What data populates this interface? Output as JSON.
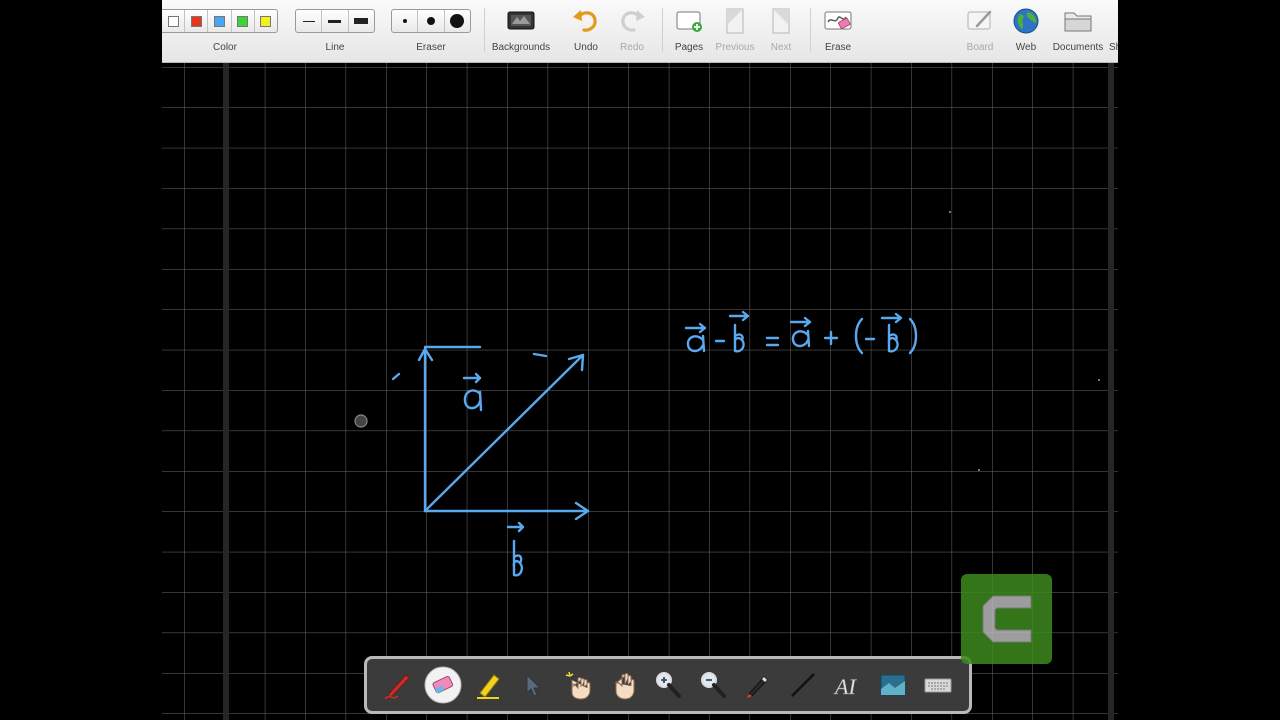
{
  "toolbar": {
    "color_label": "Color",
    "line_label": "Line",
    "eraser_label": "Eraser",
    "backgrounds_label": "Backgrounds",
    "undo_label": "Undo",
    "redo_label": "Redo",
    "pages_label": "Pages",
    "previous_label": "Previous",
    "next_label": "Next",
    "erase_label": "Erase",
    "board_label": "Board",
    "web_label": "Web",
    "documents_label": "Documents",
    "cut_label": "Sh"
  },
  "colors": {
    "swatches": [
      "#ffffff",
      "#e8351c",
      "#4aa6f2",
      "#3fd33a",
      "#f6ef1f"
    ],
    "ink": "#5aa9ee",
    "board": "#000000",
    "grid": "#6a6a6a"
  },
  "board": {
    "equation_text": "a - b = a + (- b)",
    "vector_a_label": "a",
    "vector_b_label": "b"
  },
  "bottom_tools": [
    "red-pen-icon",
    "eraser-icon",
    "highlighter-icon",
    "pointer-icon",
    "magic-hand-icon",
    "pan-hand-icon",
    "zoom-in-icon",
    "zoom-out-icon",
    "laser-pen-icon",
    "line-tool-icon",
    "text-recognition-icon",
    "screen-capture-icon",
    "keyboard-icon"
  ]
}
